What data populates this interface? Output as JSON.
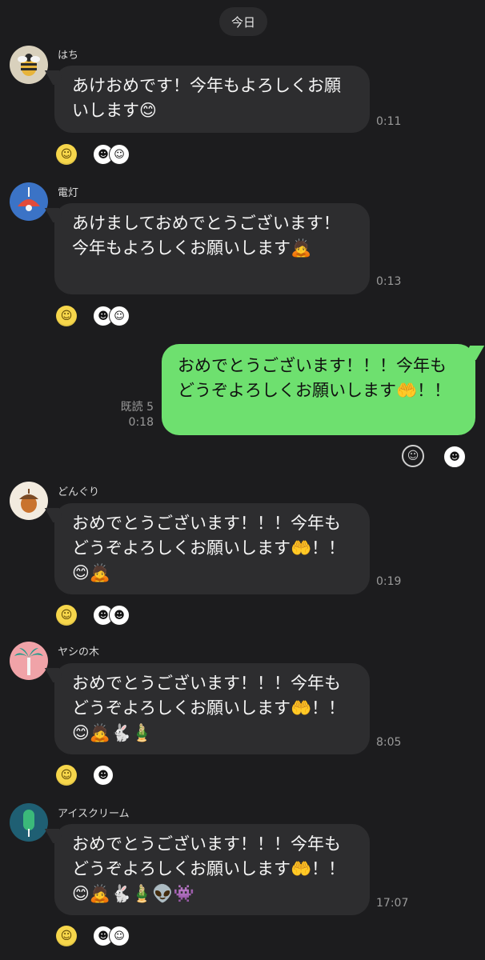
{
  "chat": {
    "date_label": "今日"
  },
  "messages": [
    {
      "sender": "はち",
      "text": "あけおめです！今年もよろしくお願いします😊",
      "time": "0:11",
      "avatar_icon": "bee-icon"
    },
    {
      "sender": "電灯",
      "text": "あけましておめでとうございます！今年もよろしくお願いします🙇",
      "time": "0:13",
      "avatar_icon": "lamp-icon"
    },
    {
      "sender": "どんぐり",
      "text": "おめでとうございます！！！今年もどうぞよろしくお願いします🤲！！😊🙇",
      "time": "0:19",
      "avatar_icon": "acorn-icon"
    },
    {
      "sender": "ヤシの木",
      "text": "おめでとうございます！！！今年もどうぞよろしくお願いします🤲！！😊🙇🐇🎍",
      "time": "8:05",
      "avatar_icon": "palm-tree-icon"
    },
    {
      "sender": "アイスクリーム",
      "text": "おめでとうございます！！！今年もどうぞよろしくお願いします🤲！！😊🙇🐇🎍👽👾",
      "time": "17:07",
      "avatar_icon": "ice-cream-icon"
    }
  ],
  "outgoing": {
    "text": "おめでとうございます！！！今年もどうぞよろしくお願いします🤲！！",
    "read_label": "既読 5",
    "time": "0:18"
  },
  "reaction_glyphs": {
    "smile": "☺",
    "stamp_a": "☻",
    "stamp_b": "☺"
  },
  "colors": {
    "background": "#1c1c1e",
    "incoming_bubble": "#2d2d2f",
    "outgoing_bubble": "#6ee06f",
    "reaction_yellow": "#f6d64b"
  }
}
